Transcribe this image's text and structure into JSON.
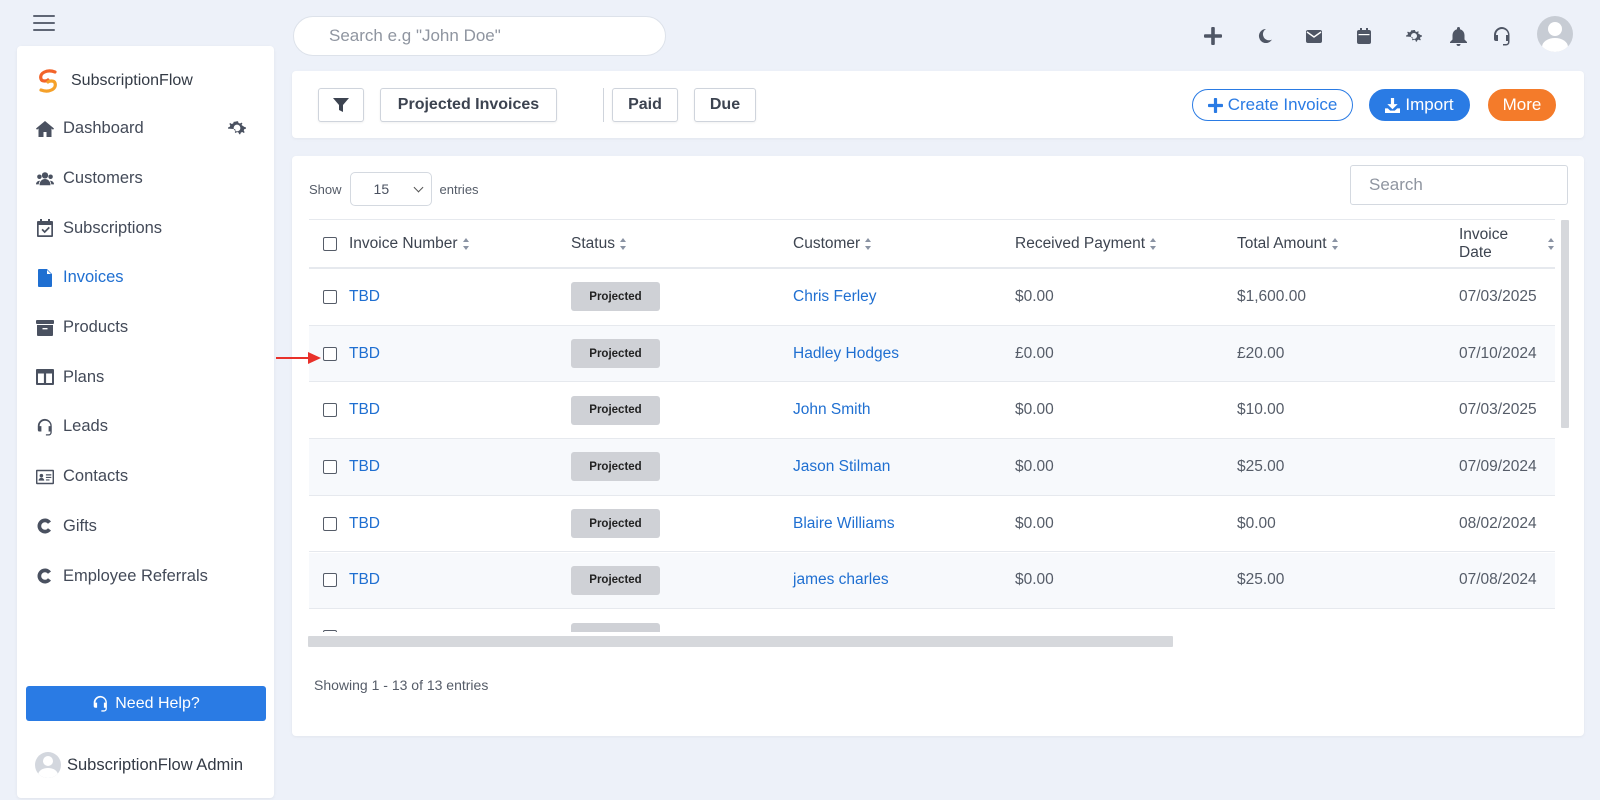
{
  "topbar": {
    "search_placeholder": "Search e.g \"John Doe\"",
    "icons": [
      "plus-icon",
      "moon-icon",
      "mail-icon",
      "calendar-icon",
      "gear-icon",
      "bell-icon",
      "headset-icon",
      "user-avatar"
    ]
  },
  "sidebar": {
    "brand": "SubscriptionFlow",
    "items": [
      {
        "label": "Dashboard",
        "icon": "home-icon"
      },
      {
        "label": "Customers",
        "icon": "users-icon"
      },
      {
        "label": "Subscriptions",
        "icon": "calendar-check-icon"
      },
      {
        "label": "Invoices",
        "icon": "invoice-icon",
        "active": true
      },
      {
        "label": "Products",
        "icon": "archive-icon"
      },
      {
        "label": "Plans",
        "icon": "columns-icon"
      },
      {
        "label": "Leads",
        "icon": "headset-icon"
      },
      {
        "label": "Contacts",
        "icon": "id-card-icon"
      },
      {
        "label": "Gifts",
        "icon": "c-icon"
      },
      {
        "label": "Employee Referrals",
        "icon": "c-icon"
      }
    ],
    "help_label": "Need Help?",
    "admin_name": "SubscriptionFlow Admin"
  },
  "toolbar": {
    "projected": "Projected Invoices",
    "paid": "Paid",
    "due": "Due",
    "create": "Create Invoice",
    "import": "Import",
    "more": "More"
  },
  "table": {
    "show_label": "Show",
    "entries_value": "15",
    "entries_label": "entries",
    "search_placeholder": "Search",
    "columns": [
      "Invoice Number",
      "Status",
      "Customer",
      "Received Payment",
      "Total Amount",
      "Invoice Date"
    ],
    "rows": [
      {
        "number": "TBD",
        "status": "Projected",
        "customer": "Chris Ferley",
        "received": "$0.00",
        "total": "$1,600.00",
        "date": "07/03/2025"
      },
      {
        "number": "TBD",
        "status": "Projected",
        "customer": "Hadley Hodges",
        "received": "£0.00",
        "total": "£20.00",
        "date": "07/10/2024"
      },
      {
        "number": "TBD",
        "status": "Projected",
        "customer": "John Smith",
        "received": "$0.00",
        "total": "$10.00",
        "date": "07/03/2025"
      },
      {
        "number": "TBD",
        "status": "Projected",
        "customer": "Jason Stilman",
        "received": "$0.00",
        "total": "$25.00",
        "date": "07/09/2024"
      },
      {
        "number": "TBD",
        "status": "Projected",
        "customer": "Blaire Williams",
        "received": "$0.00",
        "total": "$0.00",
        "date": "08/02/2024"
      },
      {
        "number": "TBD",
        "status": "Projected",
        "customer": "james charles",
        "received": "$0.00",
        "total": "$25.00",
        "date": "07/08/2024"
      }
    ],
    "footer": "Showing 1 - 13 of 13 entries"
  },
  "colors": {
    "accent": "#2a7be4",
    "link": "#1f6fd1",
    "more_button": "#f47b2a",
    "background": "#edf1f9",
    "pointer_arrow": "#e8312a"
  }
}
